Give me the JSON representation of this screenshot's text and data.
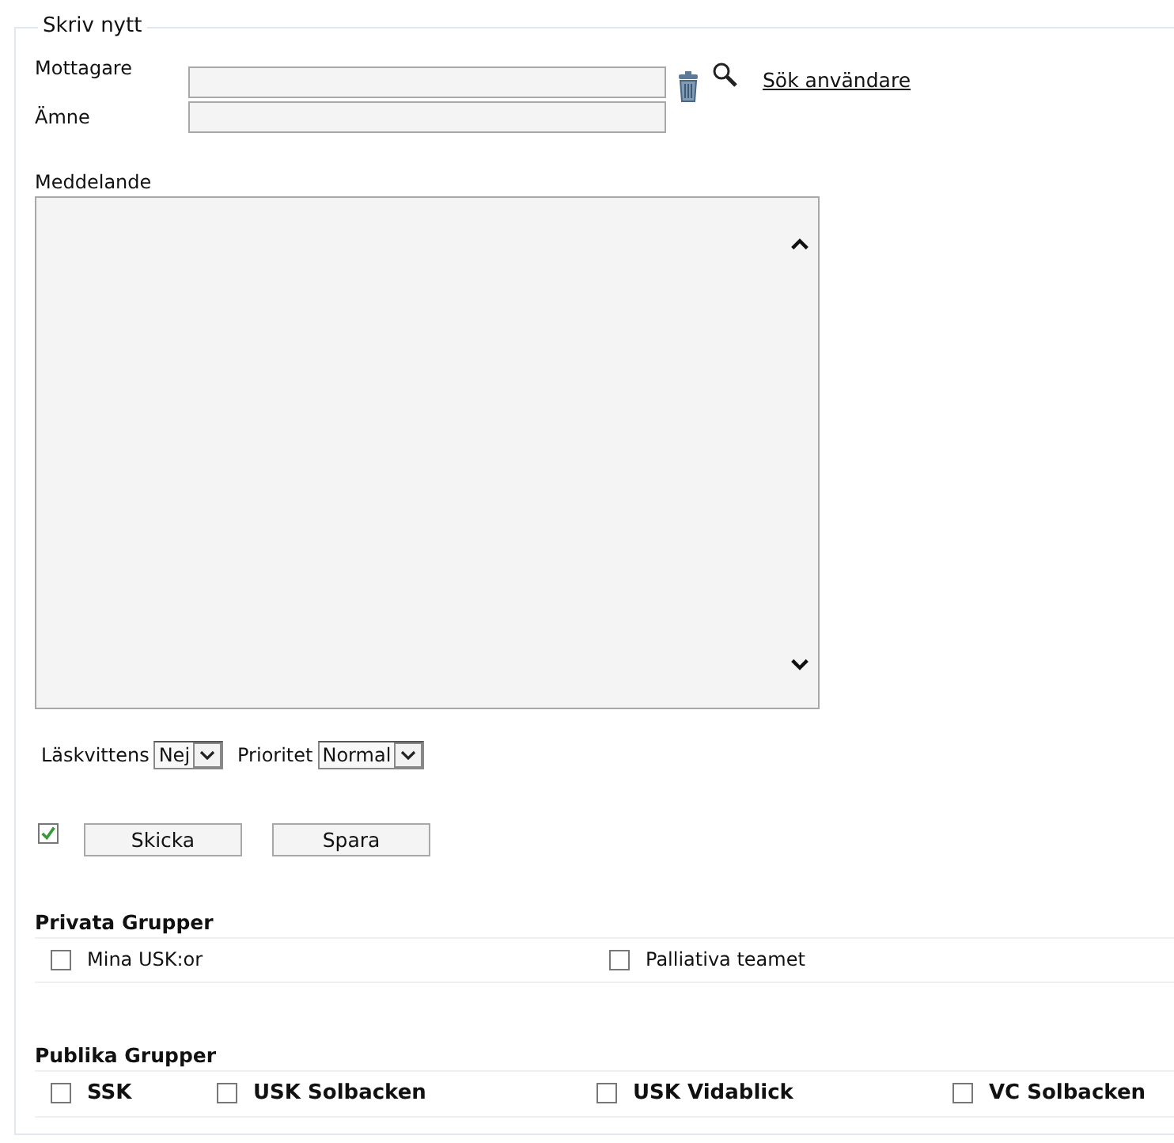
{
  "form": {
    "legend": "Skriv nytt",
    "recipient": {
      "label": "Mottagare",
      "search_link": "Sök användare"
    },
    "subject": {
      "label": "Ämne"
    },
    "message": {
      "label": "Meddelande"
    },
    "options": [
      {
        "label": "Läskvittens",
        "value": "Nej"
      },
      {
        "label": "Prioritet",
        "value": "Normal"
      }
    ],
    "confirm_checkbox": {
      "checked": true
    },
    "buttons": [
      "Skicka",
      "Spara"
    ]
  },
  "groups": [
    {
      "kind": "private",
      "title": "Privata Grupper",
      "items": [
        {
          "label": "Mina USK:or",
          "checked": false
        },
        {
          "label": "Palliativa teamet",
          "checked": false
        }
      ]
    },
    {
      "kind": "public",
      "title": "Publika Grupper",
      "items": [
        {
          "label": "SSK",
          "checked": false
        },
        {
          "label": "USK Solbacken",
          "checked": false
        },
        {
          "label": "USK Vidablick",
          "checked": false
        },
        {
          "label": "VC Solbacken",
          "checked": false
        }
      ]
    }
  ]
}
